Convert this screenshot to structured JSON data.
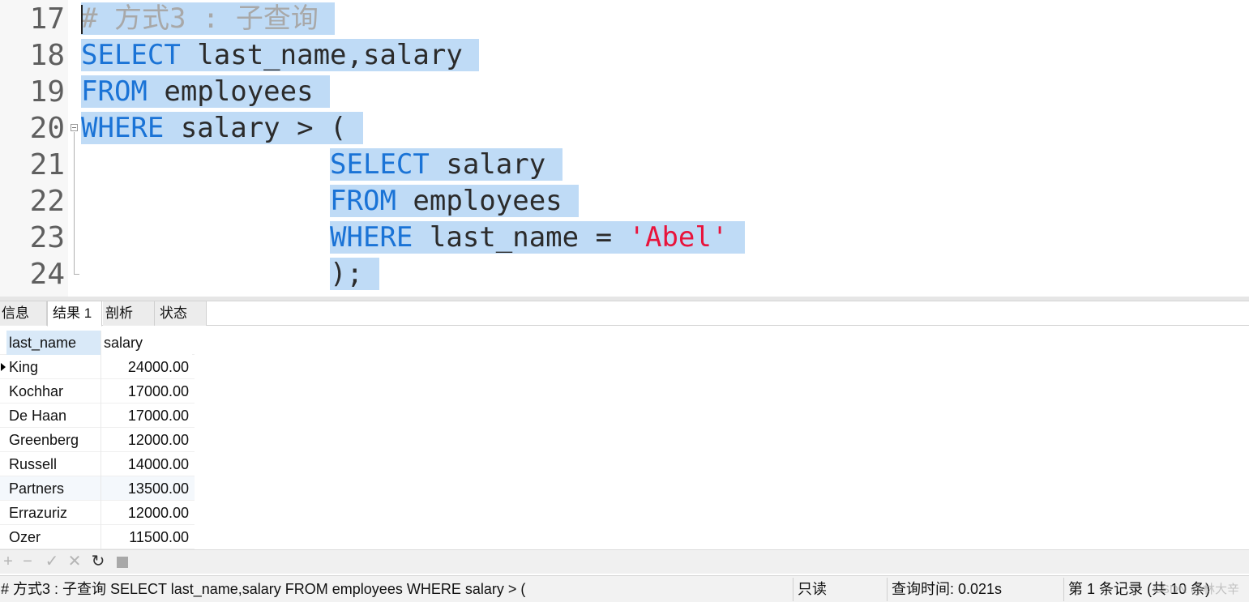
{
  "editor": {
    "line_numbers": [
      "17",
      "18",
      "19",
      "20",
      "21",
      "22",
      "23",
      "24"
    ],
    "lines": [
      [
        {
          "t": "# 方式3 : 子查询",
          "c": "cmt"
        },
        {
          "t": " ",
          "c": ""
        }
      ],
      [
        {
          "t": "SELECT",
          "c": "kw"
        },
        {
          "t": " last_name,salary ",
          "c": ""
        }
      ],
      [
        {
          "t": "FROM",
          "c": "kw"
        },
        {
          "t": " employees ",
          "c": ""
        }
      ],
      [
        {
          "t": "WHERE",
          "c": "kw"
        },
        {
          "t": " salary > ( ",
          "c": ""
        }
      ],
      [
        {
          "t": "               ",
          "c": ""
        },
        {
          "t": "SELECT",
          "c": "kw"
        },
        {
          "t": " salary ",
          "c": ""
        }
      ],
      [
        {
          "t": "               ",
          "c": ""
        },
        {
          "t": "FROM",
          "c": "kw"
        },
        {
          "t": " employees ",
          "c": ""
        }
      ],
      [
        {
          "t": "               ",
          "c": ""
        },
        {
          "t": "WHERE",
          "c": "kw"
        },
        {
          "t": " last_name = ",
          "c": ""
        },
        {
          "t": "'Abel'",
          "c": "str"
        },
        {
          "t": " ",
          "c": ""
        }
      ],
      [
        {
          "t": "               ",
          "c": ""
        },
        {
          "t": "); ",
          "c": ""
        }
      ]
    ]
  },
  "tabs": [
    {
      "label": "信息",
      "active": false
    },
    {
      "label": "结果 1",
      "active": true
    },
    {
      "label": "剖析",
      "active": false
    },
    {
      "label": "状态",
      "active": false
    }
  ],
  "grid": {
    "columns": [
      "last_name",
      "salary"
    ],
    "rows": [
      [
        "King",
        "24000.00"
      ],
      [
        "Kochhar",
        "17000.00"
      ],
      [
        "De Haan",
        "17000.00"
      ],
      [
        "Greenberg",
        "12000.00"
      ],
      [
        "Russell",
        "14000.00"
      ],
      [
        "Partners",
        "13500.00"
      ],
      [
        "Errazuriz",
        "12000.00"
      ],
      [
        "Ozer",
        "11500.00"
      ]
    ],
    "current_row": 0
  },
  "toolbar": {
    "buttons": [
      {
        "name": "add-record-button",
        "icon": "plus-icon",
        "glyph": "+",
        "enabled": false
      },
      {
        "name": "delete-record-button",
        "icon": "minus-icon",
        "glyph": "−",
        "enabled": false
      },
      {
        "name": "apply-changes-button",
        "icon": "check-icon",
        "glyph": "✓",
        "enabled": false
      },
      {
        "name": "discard-changes-button",
        "icon": "cross-icon",
        "glyph": "✕",
        "enabled": false
      },
      {
        "name": "refresh-button",
        "icon": "refresh-icon",
        "glyph": "↻",
        "enabled": true
      },
      {
        "name": "stop-button",
        "icon": "stop-icon",
        "glyph": "",
        "enabled": false
      }
    ]
  },
  "status": {
    "query_text": "# 方式3 :  子查询 SELECT last_name,salary FROM employees WHERE salary > (",
    "mode": "只读",
    "query_time": "查询时间: 0.021s",
    "record_info": "第 1 条记录 (共 10 条)",
    "watermark": "CSDN @林大辛"
  },
  "colors": {
    "keyword": "#1a73d6",
    "string": "#e8143c",
    "comment": "#a8a8a8",
    "selection": "#bfdbf6"
  }
}
